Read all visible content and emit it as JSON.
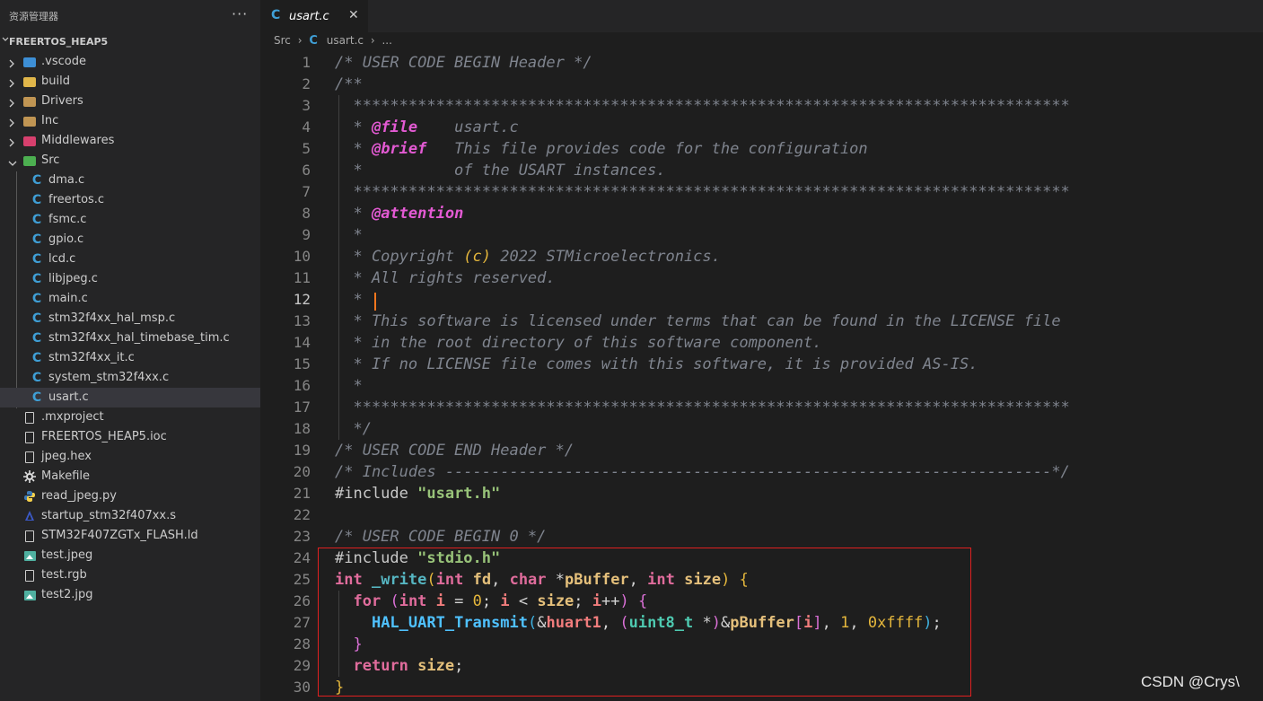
{
  "explorer": {
    "title": "资源管理器",
    "more": "···",
    "root_label": "FREERTOS_HEAP5",
    "items": [
      {
        "label": ".vscode",
        "type": "folder",
        "icon": "vscode-folder-icon",
        "color": "#3d8fd6"
      },
      {
        "label": "build",
        "type": "folder",
        "icon": "build-folder-icon",
        "color": "#e0b64a"
      },
      {
        "label": "Drivers",
        "type": "folder",
        "icon": "folder-icon",
        "color": "#c09553"
      },
      {
        "label": "Inc",
        "type": "folder",
        "icon": "folder-icon",
        "color": "#c09553"
      },
      {
        "label": "Middlewares",
        "type": "folder",
        "icon": "middlewares-folder-icon",
        "color": "#d7406e"
      },
      {
        "label": "Src",
        "type": "folder-open",
        "icon": "src-folder-icon",
        "color": "#4caf50"
      },
      {
        "label": "dma.c",
        "type": "c",
        "icon": "c-file-icon"
      },
      {
        "label": "freertos.c",
        "type": "c",
        "icon": "c-file-icon"
      },
      {
        "label": "fsmc.c",
        "type": "c",
        "icon": "c-file-icon"
      },
      {
        "label": "gpio.c",
        "type": "c",
        "icon": "c-file-icon"
      },
      {
        "label": "lcd.c",
        "type": "c",
        "icon": "c-file-icon"
      },
      {
        "label": "libjpeg.c",
        "type": "c",
        "icon": "c-file-icon"
      },
      {
        "label": "main.c",
        "type": "c",
        "icon": "c-file-icon"
      },
      {
        "label": "stm32f4xx_hal_msp.c",
        "type": "c",
        "icon": "c-file-icon"
      },
      {
        "label": "stm32f4xx_hal_timebase_tim.c",
        "type": "c",
        "icon": "c-file-icon"
      },
      {
        "label": "stm32f4xx_it.c",
        "type": "c",
        "icon": "c-file-icon"
      },
      {
        "label": "system_stm32f4xx.c",
        "type": "c",
        "icon": "c-file-icon"
      },
      {
        "label": "usart.c",
        "type": "c",
        "icon": "c-file-icon",
        "selected": true
      },
      {
        "label": ".mxproject",
        "type": "doc",
        "icon": "file-icon"
      },
      {
        "label": "FREERTOS_HEAP5.ioc",
        "type": "doc",
        "icon": "file-icon"
      },
      {
        "label": "jpeg.hex",
        "type": "doc",
        "icon": "file-icon"
      },
      {
        "label": "Makefile",
        "type": "make",
        "icon": "makefile-icon"
      },
      {
        "label": "read_jpeg.py",
        "type": "py",
        "icon": "python-icon"
      },
      {
        "label": "startup_stm32f407xx.s",
        "type": "asm",
        "icon": "assembly-icon"
      },
      {
        "label": "STM32F407ZGTx_FLASH.ld",
        "type": "doc",
        "icon": "file-icon"
      },
      {
        "label": "test.jpeg",
        "type": "img",
        "icon": "image-icon"
      },
      {
        "label": "test.rgb",
        "type": "doc",
        "icon": "file-icon"
      },
      {
        "label": "test2.jpg",
        "type": "img",
        "icon": "image-icon"
      }
    ]
  },
  "tab": {
    "label": "usart.c",
    "close": "✕"
  },
  "breadcrumb": {
    "folder": "Src",
    "sep": "›",
    "file": "usart.c",
    "more": "..."
  },
  "editor": {
    "current_line": 12,
    "line_numbers": [
      "1",
      "2",
      "3",
      "4",
      "5",
      "6",
      "7",
      "8",
      "9",
      "10",
      "11",
      "12",
      "13",
      "14",
      "15",
      "16",
      "17",
      "18",
      "19",
      "20",
      "21",
      "22",
      "23",
      "24",
      "25",
      "26",
      "27",
      "28",
      "29",
      "30"
    ],
    "lines": [
      [
        [
          "cm",
          "/* USER CODE BEGIN Header */"
        ]
      ],
      [
        [
          "cm",
          "/**"
        ]
      ],
      [
        [
          "cm",
          "  ******************************************************************************"
        ]
      ],
      [
        [
          "cm",
          "  * "
        ],
        [
          "tag",
          "@file"
        ],
        [
          "cm",
          "    usart.c"
        ]
      ],
      [
        [
          "cm",
          "  * "
        ],
        [
          "tag",
          "@brief"
        ],
        [
          "cm",
          "   This file provides code for the configuration"
        ]
      ],
      [
        [
          "cm",
          "  *          of the USART instances."
        ]
      ],
      [
        [
          "cm",
          "  ******************************************************************************"
        ]
      ],
      [
        [
          "cm",
          "  * "
        ],
        [
          "tag",
          "@attention"
        ]
      ],
      [
        [
          "cm",
          "  *"
        ]
      ],
      [
        [
          "cm",
          "  * Copyright "
        ],
        [
          "pa",
          "(c)"
        ],
        [
          "cm",
          " 2022 STMicroelectronics."
        ]
      ],
      [
        [
          "cm",
          "  * All rights reserved."
        ]
      ],
      [
        [
          "cm",
          "  *"
        ]
      ],
      [
        [
          "cm",
          "  * This software is licensed under terms that can be found in the LICENSE file"
        ]
      ],
      [
        [
          "cm",
          "  * in the root directory of this software component."
        ]
      ],
      [
        [
          "cm",
          "  * If no LICENSE file comes with this software, it is provided AS-IS."
        ]
      ],
      [
        [
          "cm",
          "  *"
        ]
      ],
      [
        [
          "cm",
          "  ******************************************************************************"
        ]
      ],
      [
        [
          "cm",
          "  */"
        ]
      ],
      [
        [
          "cm",
          "/* USER CODE END Header */"
        ]
      ],
      [
        [
          "cm",
          "/* Includes ------------------------------------------------------------------*/"
        ]
      ],
      [
        [
          "pp",
          "#include "
        ],
        [
          "str",
          "\"usart.h\""
        ]
      ],
      [
        [
          "op",
          ""
        ]
      ],
      [
        [
          "cm",
          "/* USER CODE BEGIN 0 */"
        ]
      ],
      [
        [
          "pp",
          "#include "
        ],
        [
          "str",
          "\"stdio.h\""
        ]
      ],
      [
        [
          "ty",
          "int"
        ],
        [
          "op",
          " "
        ],
        [
          "fn",
          "_write"
        ],
        [
          "br1",
          "("
        ],
        [
          "ty",
          "int"
        ],
        [
          "op",
          " "
        ],
        [
          "var",
          "fd"
        ],
        [
          "op",
          ", "
        ],
        [
          "ty",
          "char"
        ],
        [
          "op",
          " *"
        ],
        [
          "var",
          "pBuffer"
        ],
        [
          "op",
          ", "
        ],
        [
          "ty",
          "int"
        ],
        [
          "op",
          " "
        ],
        [
          "var",
          "size"
        ],
        [
          "br1",
          ")"
        ],
        [
          "op",
          " "
        ],
        [
          "br1",
          "{"
        ]
      ],
      [
        [
          "op",
          "  "
        ],
        [
          "kw",
          "for"
        ],
        [
          "op",
          " "
        ],
        [
          "br2",
          "("
        ],
        [
          "ty",
          "int"
        ],
        [
          "op",
          " "
        ],
        [
          "vr",
          "i"
        ],
        [
          "op",
          " = "
        ],
        [
          "num",
          "0"
        ],
        [
          "op",
          "; "
        ],
        [
          "vr",
          "i"
        ],
        [
          "op",
          " < "
        ],
        [
          "var",
          "size"
        ],
        [
          "op",
          "; "
        ],
        [
          "vr",
          "i"
        ],
        [
          "op",
          "++"
        ],
        [
          "br2",
          ")"
        ],
        [
          "op",
          " "
        ],
        [
          "br2",
          "{"
        ]
      ],
      [
        [
          "op",
          "    "
        ],
        [
          "fn2",
          "HAL_UART_Transmit"
        ],
        [
          "br3",
          "("
        ],
        [
          "op",
          "&"
        ],
        [
          "vr",
          "huart1"
        ],
        [
          "op",
          ", "
        ],
        [
          "br2",
          "("
        ],
        [
          "tyc",
          "uint8_t"
        ],
        [
          "op",
          " *"
        ],
        [
          "br2",
          ")"
        ],
        [
          "op",
          "&"
        ],
        [
          "var",
          "pBuffer"
        ],
        [
          "br2",
          "["
        ],
        [
          "vr",
          "i"
        ],
        [
          "br2",
          "]"
        ],
        [
          "op",
          ", "
        ],
        [
          "num",
          "1"
        ],
        [
          "op",
          ", "
        ],
        [
          "num",
          "0xffff"
        ],
        [
          "br3",
          ")"
        ],
        [
          "op",
          ";"
        ]
      ],
      [
        [
          "op",
          "  "
        ],
        [
          "br2",
          "}"
        ]
      ],
      [
        [
          "op",
          "  "
        ],
        [
          "kw",
          "return"
        ],
        [
          "op",
          " "
        ],
        [
          "var",
          "size"
        ],
        [
          "op",
          ";"
        ]
      ],
      [
        [
          "br1",
          "}"
        ]
      ]
    ]
  },
  "watermark": "CSDN @Crys\\"
}
